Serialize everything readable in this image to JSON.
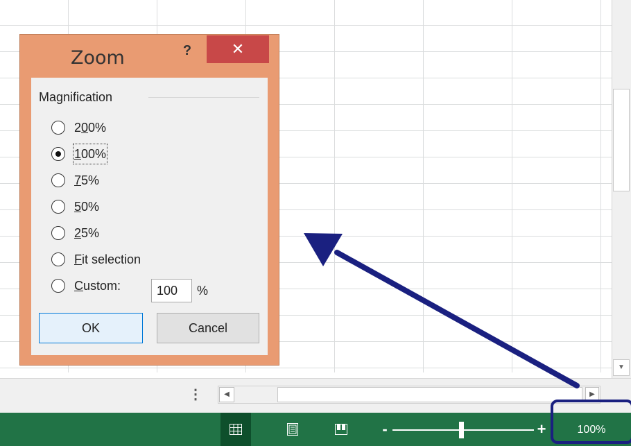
{
  "dialog": {
    "title": "Zoom",
    "help": "?",
    "close": "✕",
    "group_title": "Magnification",
    "options": [
      {
        "pre": "2",
        "key": "0",
        "post": "0%",
        "selected": false
      },
      {
        "pre": "",
        "key": "1",
        "post": "00%",
        "selected": true
      },
      {
        "pre": "",
        "key": "7",
        "post": "5%",
        "selected": false
      },
      {
        "pre": "",
        "key": "5",
        "post": "0%",
        "selected": false
      },
      {
        "pre": "",
        "key": "2",
        "post": "5%",
        "selected": false
      },
      {
        "pre": "",
        "key": "F",
        "post": "it selection",
        "selected": false
      },
      {
        "pre": "",
        "key": "C",
        "post": "ustom:",
        "selected": false
      }
    ],
    "custom_value": "100",
    "custom_unit": "%",
    "ok_label": "OK",
    "cancel_label": "Cancel"
  },
  "statusbar": {
    "zoom_level": "100%",
    "zoom_slider_percent": 100,
    "accent_color": "#217346"
  },
  "icons": {
    "normal_view": "grid-icon",
    "page_layout_view": "page-layout-icon",
    "page_break_view": "page-break-icon"
  },
  "annotation": {
    "arrow_color": "#1a2080",
    "highlight_color": "#1a2080"
  }
}
